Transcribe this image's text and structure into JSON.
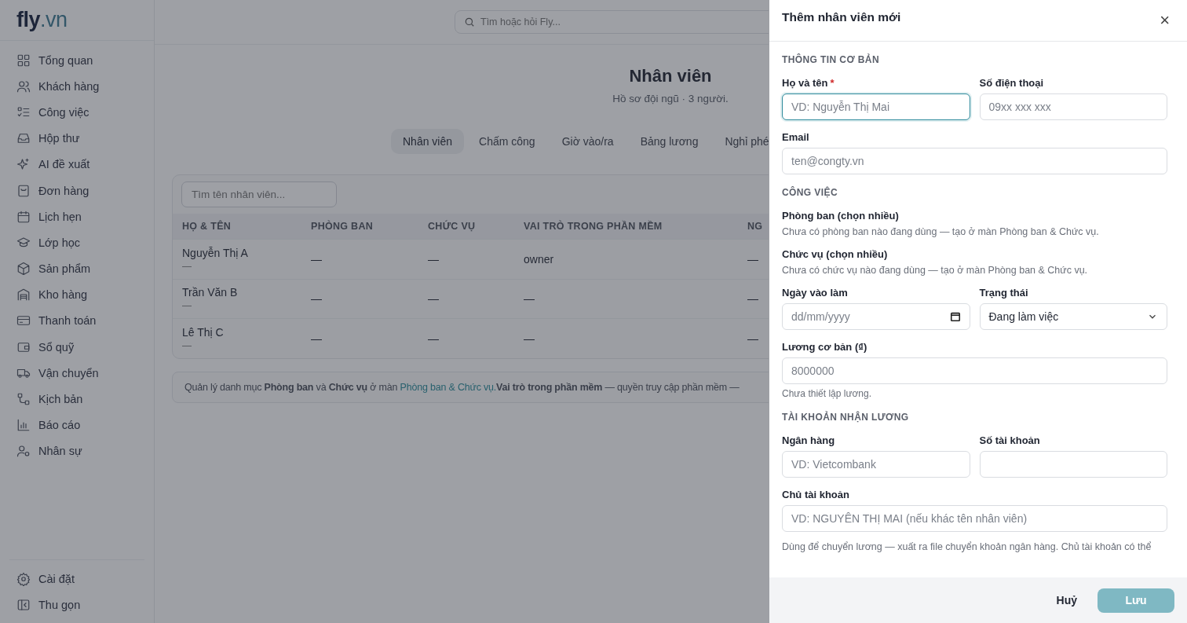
{
  "sidebar": {
    "logo": {
      "main": "fly",
      "suffix": ".vn"
    },
    "items": [
      {
        "label": "Tổng quan",
        "selected": false
      },
      {
        "label": "Khách hàng",
        "selected": false
      },
      {
        "label": "Công việc",
        "selected": false
      },
      {
        "label": "Hộp thư",
        "selected": false
      },
      {
        "label": "AI đề xuất",
        "selected": false
      },
      {
        "label": "Đơn hàng",
        "selected": false
      },
      {
        "label": "Lịch hẹn",
        "selected": false
      },
      {
        "label": "Lớp học",
        "selected": false
      },
      {
        "label": "Sản phẩm",
        "selected": false
      },
      {
        "label": "Kho hàng",
        "selected": false
      },
      {
        "label": "Thanh toán",
        "selected": false
      },
      {
        "label": "Sổ quỹ",
        "selected": false
      },
      {
        "label": "Vận chuyển",
        "selected": false
      },
      {
        "label": "Kịch bản",
        "selected": false
      },
      {
        "label": "Báo cáo",
        "selected": false
      },
      {
        "label": "Nhân sự",
        "selected": false
      }
    ],
    "bottom_items": [
      {
        "label": "Cài đặt"
      },
      {
        "label": "Thu gọn"
      }
    ]
  },
  "search": {
    "placeholder": "Tìm hoặc hỏi Fly..."
  },
  "page": {
    "title": "Nhân viên",
    "subtitle": "Hồ sơ đội ngũ · 3 người.",
    "tabs": [
      {
        "label": "Nhân viên",
        "selected": true
      },
      {
        "label": "Chấm công",
        "selected": false
      },
      {
        "label": "Giờ vào/ra",
        "selected": false
      },
      {
        "label": "Bảng lương",
        "selected": false
      },
      {
        "label": "Nghỉ phé",
        "selected": false
      }
    ],
    "table_search": {
      "placeholder": "Tìm tên nhân viên..."
    },
    "table": {
      "columns": [
        "HỌ & TÊN",
        "PHÒNG BAN",
        "CHỨC VỤ",
        "VAI TRÒ TRONG PHẦN MỀM",
        "NG"
      ],
      "rows": [
        {
          "cells": [
            "Nguyễn Thị A",
            "—",
            "—",
            "owner",
            "—"
          ],
          "sub": "—"
        },
        {
          "cells": [
            "Trần Văn B",
            "—",
            "—",
            "—",
            "—"
          ],
          "sub": "—"
        },
        {
          "cells": [
            "Lê Thị C",
            "—",
            "—",
            "—",
            "—"
          ],
          "sub": "—"
        }
      ]
    },
    "note": {
      "text": "Quản lý danh mục **Phòng ban** và **Chức vụ** ở màn ",
      "link": "Phòng ban & Chức vụ.",
      "rest": "**Vai trò trong phần mềm** — quyền truy cập phần mềm —"
    }
  },
  "drawer": {
    "title": "Thêm nhân viên mới",
    "close": "×",
    "sections": [
      {
        "heading": "THÔNG TIN CƠ BẢN",
        "rows": [
          [
            {
              "kind": "input",
              "label": "Họ và tên",
              "required_mark": "*",
              "placeholder": "VD: Nguyễn Thị Mai",
              "focused": true
            },
            {
              "kind": "input",
              "label": "Số điện thoại",
              "placeholder": "09xx xxx xxx",
              "focused": false
            }
          ],
          [
            {
              "kind": "input",
              "label": "Email",
              "placeholder": "ten@congty.vn",
              "focused": false
            }
          ]
        ]
      },
      {
        "heading": "CÔNG VIỆC",
        "rows": [
          [
            {
              "kind": "note",
              "label": "Phòng ban (chọn nhiều)",
              "help": "Chưa có phòng ban nào đang dùng — tạo ở màn Phòng ban & Chức vụ."
            }
          ],
          [
            {
              "kind": "note",
              "label": "Chức vụ (chọn nhiều)",
              "help": "Chưa có chức vụ nào đang dùng — tạo ở màn Phòng ban & Chức vụ."
            }
          ],
          [
            {
              "kind": "date",
              "label": "Ngày vào làm",
              "placeholder": "dd/mm/yyyy"
            },
            {
              "kind": "select",
              "label": "Trạng thái",
              "value": "Đang làm việc"
            }
          ],
          [
            {
              "kind": "input",
              "label": "Lương cơ bản (₫)",
              "placeholder": "8000000",
              "focused": false,
              "hint": "Chưa thiết lập lương."
            }
          ]
        ]
      },
      {
        "heading": "TÀI KHOẢN NHẬN LƯƠNG",
        "rows": [
          [
            {
              "kind": "input",
              "label": "Ngân hàng",
              "placeholder": "VD: Vietcombank",
              "focused": false
            },
            {
              "kind": "input",
              "label": "Số tài khoản",
              "focused": false
            }
          ],
          [
            {
              "kind": "input",
              "label": "Chủ tài khoản",
              "placeholder": "VD: NGUYÊN THỊ MAI (nếu khác tên nhân viên)",
              "focused": false
            }
          ]
        ]
      }
    ],
    "footer_note": "Dùng để chuyển lương — xuất ra file chuyển khoản ngân hàng. Chủ tài khoản có thể",
    "buttons": [
      {
        "label": "Huỷ",
        "kind": "secondary"
      },
      {
        "label": "Lưu",
        "kind": "primary",
        "disabled": true
      }
    ]
  }
}
